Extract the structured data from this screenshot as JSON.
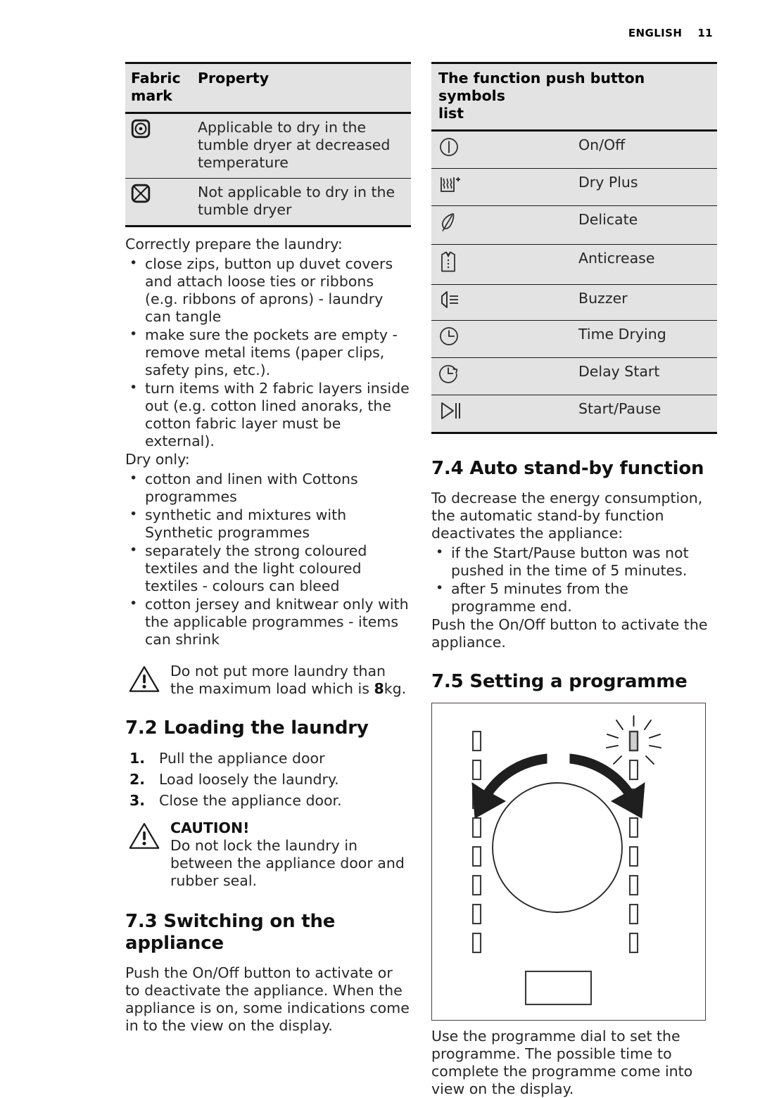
{
  "header": {
    "language": "ENGLISH",
    "page_number": "11"
  },
  "fabric_table": {
    "headers": [
      "Fabric mark",
      "Property"
    ],
    "header_col1_line1": "Fabric",
    "header_col1_line2": "mark",
    "header_col2": "Property",
    "rows": [
      {
        "icon": "tumble-dry-low-heat-icon",
        "property": "Applicable to dry in the tumble dryer at decreased temperature"
      },
      {
        "icon": "do-not-tumble-dry-icon",
        "property": "Not applicable to dry in the tumble dryer"
      }
    ]
  },
  "prepare": {
    "intro": "Correctly prepare the laundry:",
    "bullets": [
      "close zips, button up duvet covers and attach loose ties or ribbons (e.g. ribbons of aprons) - laundry can tangle",
      "make sure the pockets are empty - remove metal items (paper clips, safety pins, etc.).",
      "turn items with 2 fabric layers inside out (e.g. cotton lined anoraks, the cotton fabric layer must be external)."
    ],
    "dry_only_label": "Dry only:",
    "dry_only_bullets": [
      "cotton and linen with Cottons programmes",
      "synthetic and mixtures with Synthetic programmes",
      "separately the strong coloured textiles and the light coloured textiles - colours can bleed",
      "cotton jersey and knitwear only with the applicable programmes - items can shrink"
    ]
  },
  "max_load_warning": {
    "icon": "warning-triangle-icon",
    "text_before": "Do not put more laundry than the maximum load which is ",
    "value": "8",
    "text_after": "kg."
  },
  "section_72": {
    "number": "7.2",
    "title": "Loading the laundry",
    "steps": [
      "Pull the appliance door",
      "Load loosely the laundry.",
      "Close the appliance door."
    ]
  },
  "caution": {
    "icon": "warning-triangle-icon",
    "title": "CAUTION!",
    "text": "Do not lock the laundry in between the appliance door and rubber seal."
  },
  "section_73": {
    "number": "7.3",
    "title": "Switching on the appliance",
    "body": "Push the On/Off button to activate or to deactivate the appliance. When the appliance is on, some indications come in to the view on the display."
  },
  "symbols_table": {
    "header_line1": "The function push button symbols",
    "header_line2": "list",
    "rows": [
      {
        "icon": "power-on-off-icon",
        "label": "On/Off"
      },
      {
        "icon": "dry-plus-icon",
        "label": "Dry Plus"
      },
      {
        "icon": "feather-delicate-icon",
        "label": "Delicate"
      },
      {
        "icon": "shirt-anticrease-icon",
        "label": "Anticrease"
      },
      {
        "icon": "speaker-buzzer-icon",
        "label": "Buzzer"
      },
      {
        "icon": "clock-time-drying-icon",
        "label": "Time Drying"
      },
      {
        "icon": "clock-arrow-delay-start-icon",
        "label": "Delay Start"
      },
      {
        "icon": "play-pause-icon",
        "label": "Start/Pause"
      }
    ]
  },
  "section_74": {
    "number": "7.4",
    "title": "Auto stand-by function",
    "intro": "To decrease the energy consumption, the automatic stand-by function deactivates the appliance:",
    "bullets": [
      "if the Start/Pause button was not pushed in the time of 5 minutes.",
      "after 5 minutes from the programme end."
    ],
    "outro": "Push the On/Off button to activate the appliance."
  },
  "section_75": {
    "number": "7.5",
    "title": "Setting a programme",
    "figure": {
      "name": "programme-dial-figure",
      "left_ticks": 8,
      "right_ticks": 8,
      "highlighted_tick_index": 0,
      "highlighted_tick_fill": "#cfcfcf",
      "arrows": [
        "rotate-left-arrow",
        "rotate-right-arrow"
      ],
      "dial": "programme-dial-circle",
      "display": "display-panel-rectangle",
      "frame_color": "#4a3f4a"
    },
    "caption": "Use the programme dial to set the programme. The possible time to complete the programme come into view on the display."
  }
}
